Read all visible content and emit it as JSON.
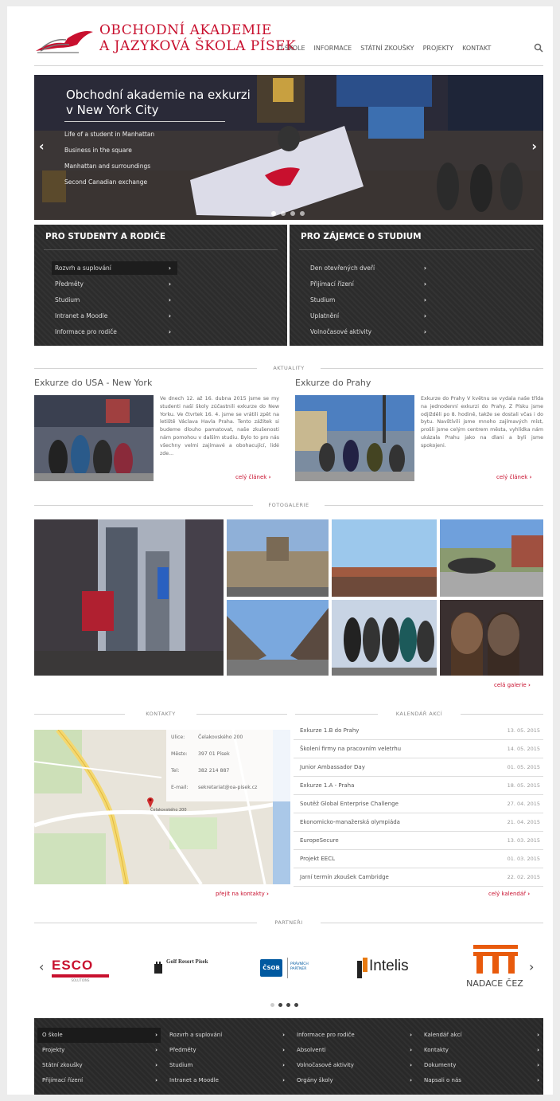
{
  "header": {
    "logo_line1": "OBCHODNÍ AKADEMIE",
    "logo_line2": "A JAZYKOVÁ ŠKOLA PÍSEK",
    "nav": [
      "O ŠKOLE",
      "INFORMACE",
      "STÁTNÍ ZKOUŠKY",
      "PROJEKTY",
      "KONTAKT"
    ]
  },
  "hero": {
    "title_line1": "Obchodní akademie  na exkurzi",
    "title_line2": "v New York City",
    "bullets": [
      "Life of a student in Manhattan",
      "Business in the square",
      "Manhattan and surroundings",
      "Second Canadian exchange"
    ],
    "slide_count": 4,
    "active_slide": 1
  },
  "boxes": [
    {
      "title": "PRO STUDENTY A RODIČE",
      "links": [
        "Rozvrh a suplování",
        "Předměty",
        "Studium",
        "Intranet a Moodle",
        "Informace pro rodiče"
      ]
    },
    {
      "title": "PRO ZÁJEMCE O STUDIUM",
      "links": [
        "Den otevřených dveří",
        "Přijímací řízení",
        "Studium",
        "Uplatnění",
        "Volnočasové aktivity"
      ]
    }
  ],
  "news": {
    "section_title": "AKTUALITY",
    "items": [
      {
        "title": "Exkurze do USA - New York",
        "text": "Ve dnech 12. až 16. dubna 2015 jsme se my studenti naší školy zúčastnili exkurze do New Yorku. Ve čtvrtek 16. 4. jsme se vrátili zpět na letiště Václava Havla Praha. Tento zážitek si budeme dlouho pamatovat, naše zkušenosti nám pomohou v dalším studiu. Bylo to pro nás všechny velmi zajímavé a obohacující, lidé zde...",
        "more": "celý článek"
      },
      {
        "title": "Exkurze do Prahy",
        "text": "Exkurze do Prahy V květnu se vydala naše třída na jednodenní exkurzi do Prahy. Z Písku jsme odjížděli po 8. hodině, takže se dostali včas i do bytu. Navštívili jsme mnoho zajímavých míst, prošli jsme celým centrem města, vyhlídka nám ukázala Prahu jako na dlani a byli jsme spokojeni.",
        "more": "celý článek"
      }
    ]
  },
  "gallery": {
    "section_title": "FOTOGALERIE",
    "more": "celá galerie"
  },
  "contacts": {
    "section_title": "KONTAKTY",
    "rows": [
      {
        "label": "Ulice:",
        "value": "Čelakovského 200"
      },
      {
        "label": "Město:",
        "value": "397 01 Písek"
      },
      {
        "label": "Tel:",
        "value": "382 214 887"
      },
      {
        "label": "E-mail:",
        "value": "sekretariat@oa-pisek.cz"
      }
    ],
    "map_pin_label": "Čelakovského 200",
    "more": "přejít na kontakty"
  },
  "calendar": {
    "section_title": "KALENDÁŘ AKCÍ",
    "events": [
      {
        "name": "Exkurze 1.B do Prahy",
        "date": "13. 05. 2015"
      },
      {
        "name": "Školení firmy na pracovním veletrhu",
        "date": "14. 05. 2015"
      },
      {
        "name": "Junior Ambassador Day",
        "date": "01. 05. 2015"
      },
      {
        "name": "Exkurze 1.A - Praha",
        "date": "18. 05. 2015"
      },
      {
        "name": "Soutěž Global Enterprise Challenge",
        "date": "27. 04. 2015"
      },
      {
        "name": "Ekonomicko-manažerská olympiáda",
        "date": "21. 04. 2015"
      },
      {
        "name": "EuropeSecure",
        "date": "13. 03. 2015"
      },
      {
        "name": "Projekt EECL",
        "date": "01. 03. 2015"
      },
      {
        "name": "Jarní termín zkoušek Cambridge",
        "date": "22. 02. 2015"
      }
    ],
    "more": "celý kalendář"
  },
  "partners": {
    "section_title": "PARTNEŘI",
    "names": [
      "ESCO",
      "Golf Resort Písek",
      "ČSOB",
      "PRÁVNÍCH PARTNER",
      "Intelis",
      "NADACE ČEZ"
    ],
    "esco_sub": "SOLUTIONS"
  },
  "footer": {
    "columns": [
      [
        "O škole",
        "Projekty",
        "Státní zkoušky",
        "Přijímací řízení"
      ],
      [
        "Rozvrh a suplování",
        "Předměty",
        "Studium",
        "Intranet a Moodle"
      ],
      [
        "Informace pro rodiče",
        "Absolventi",
        "Volnočasové aktivity",
        "Orgány školy"
      ],
      [
        "Kalendář akcí",
        "Kontakty",
        "Dokumenty",
        "Napsali o nás"
      ]
    ]
  },
  "colors": {
    "brand_red": "#c8102e",
    "dark_panel": "#2f2f2f"
  }
}
